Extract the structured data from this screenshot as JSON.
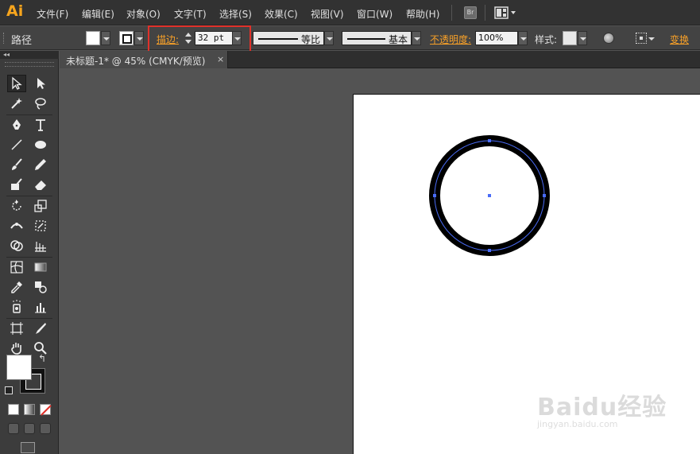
{
  "app": {
    "logo": "Ai"
  },
  "menu": {
    "items": [
      {
        "label": "文件(F)"
      },
      {
        "label": "编辑(E)"
      },
      {
        "label": "对象(O)"
      },
      {
        "label": "文字(T)"
      },
      {
        "label": "选择(S)"
      },
      {
        "label": "效果(C)"
      },
      {
        "label": "视图(V)"
      },
      {
        "label": "窗口(W)"
      },
      {
        "label": "帮助(H)"
      }
    ],
    "bridge_label": "Br"
  },
  "control": {
    "selection_label": "路径",
    "stroke_label": "描边:",
    "stroke_weight": "32 pt",
    "profile_label": "等比",
    "brush_label": "基本",
    "opacity_label": "不透明度:",
    "opacity_value": "100%",
    "style_label": "样式:",
    "transform_label": "变换"
  },
  "panel": {
    "collapse_glyph": "◂◂"
  },
  "document": {
    "tab_title": "未标题-1* @ 45% (CMYK/预览)",
    "close_glyph": "×"
  },
  "colors": {
    "accent_orange": "#f7a028",
    "highlight_red": "#e0312a",
    "path_blue": "#4a6cf7",
    "stroke_black": "#000000"
  },
  "watermark": {
    "main": "Baidu经验",
    "sub": "jingyan.baidu.com"
  }
}
